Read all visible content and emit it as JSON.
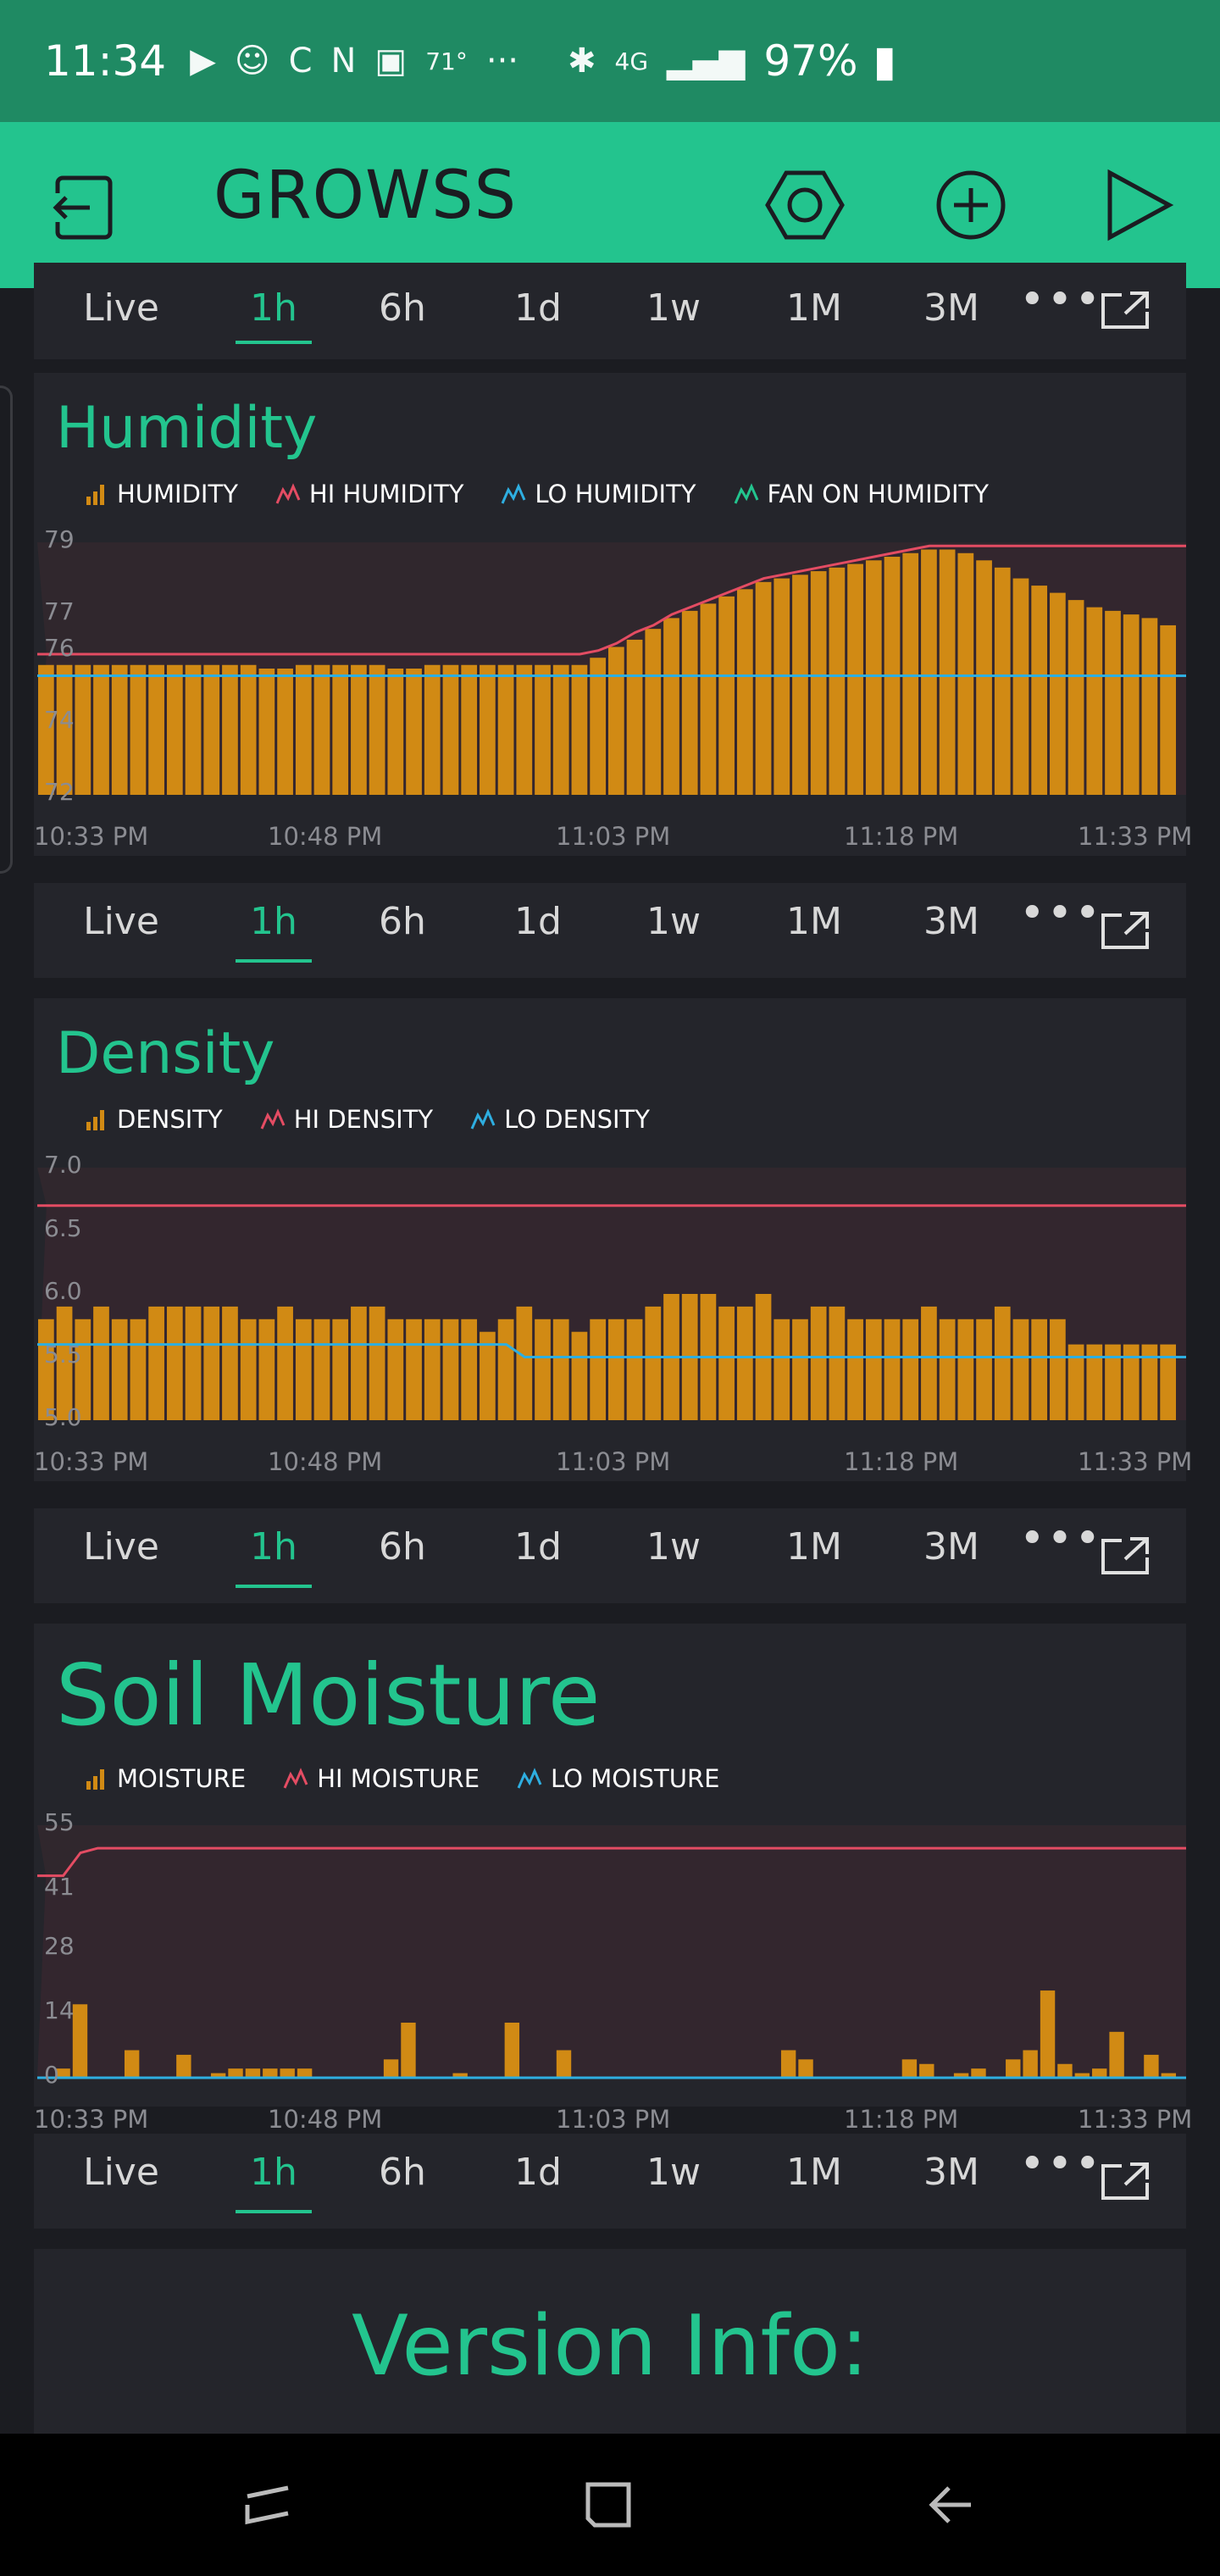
{
  "status_bar": {
    "time": "11:34",
    "temperature": "71°",
    "more": "···",
    "network": "4G",
    "battery": "97%"
  },
  "app_bar": {
    "title": "GROWSS"
  },
  "time_tabs": [
    "Live",
    "1h",
    "6h",
    "1d",
    "1w",
    "1M",
    "3M"
  ],
  "active_tab": "1h",
  "time_labels": [
    "10:33 PM",
    "10:48 PM",
    "11:03 PM",
    "11:18 PM",
    "11:33 PM"
  ],
  "colors": {
    "accent": "#23c48e",
    "bar": "#d18a14",
    "hi_line": "#e44c63",
    "lo_line": "#2eaee0",
    "fan_line": "#23c48e"
  },
  "widgets": {
    "humidity": {
      "title": "Humidity",
      "legend": [
        "HUMIDITY",
        "HI HUMIDITY",
        "LO HUMIDITY",
        "FAN ON HUMIDITY"
      ],
      "y_ticks": [
        "79",
        "77",
        "76",
        "74",
        "72"
      ]
    },
    "density": {
      "title": "Density",
      "legend": [
        "DENSITY",
        "HI DENSITY",
        "LO DENSITY"
      ],
      "y_ticks": [
        "7.0",
        "6.5",
        "6.0",
        "5.5",
        "5.0"
      ]
    },
    "soil": {
      "title": "Soil Moisture",
      "legend": [
        "MOISTURE",
        "HI MOISTURE",
        "LO MOISTURE"
      ],
      "y_ticks": [
        "55",
        "41",
        "28",
        "14",
        "0"
      ]
    }
  },
  "version": {
    "title": "Version Info:"
  },
  "chart_data": [
    {
      "type": "bar",
      "title": "Humidity",
      "ylim": [
        72,
        79
      ],
      "series": [
        {
          "name": "HUMIDITY",
          "values": [
            75.6,
            75.6,
            75.6,
            75.6,
            75.6,
            75.6,
            75.6,
            75.6,
            75.6,
            75.6,
            75.6,
            75.6,
            75.5,
            75.5,
            75.6,
            75.6,
            75.6,
            75.6,
            75.6,
            75.5,
            75.5,
            75.6,
            75.6,
            75.6,
            75.6,
            75.6,
            75.6,
            75.6,
            75.6,
            75.6,
            75.8,
            76.1,
            76.3,
            76.6,
            76.9,
            77.1,
            77.3,
            77.5,
            77.7,
            77.9,
            78.0,
            78.1,
            78.2,
            78.3,
            78.4,
            78.5,
            78.6,
            78.7,
            78.8,
            78.8,
            78.7,
            78.5,
            78.3,
            78.0,
            77.8,
            77.6,
            77.4,
            77.2,
            77.1,
            77.0,
            76.9,
            76.7
          ]
        },
        {
          "name": "HI HUMIDITY",
          "values": [
            75.9,
            75.9,
            75.9,
            75.9,
            75.9,
            75.9,
            75.9,
            75.9,
            75.9,
            75.9,
            75.9,
            75.9,
            75.9,
            75.9,
            75.9,
            75.9,
            75.9,
            75.9,
            75.9,
            75.9,
            75.9,
            75.9,
            75.9,
            75.9,
            75.9,
            75.9,
            75.9,
            75.9,
            75.9,
            75.9,
            76.0,
            76.2,
            76.5,
            76.7,
            77.0,
            77.2,
            77.4,
            77.6,
            77.8,
            78.0,
            78.1,
            78.2,
            78.3,
            78.4,
            78.5,
            78.6,
            78.7,
            78.8,
            78.9,
            78.9,
            78.9,
            78.9,
            78.9,
            78.9,
            78.9,
            78.9,
            78.9,
            78.9,
            78.9,
            78.9,
            78.9,
            78.9
          ]
        },
        {
          "name": "LO HUMIDITY",
          "values": [
            75.3,
            75.3,
            75.3,
            75.3,
            75.3,
            75.3,
            75.3,
            75.3,
            75.3,
            75.3,
            75.3,
            75.3,
            75.3,
            75.3,
            75.3,
            75.3,
            75.3,
            75.3,
            75.3,
            75.3,
            75.3,
            75.3,
            75.3,
            75.3,
            75.3,
            75.3,
            75.3,
            75.3,
            75.3,
            75.3,
            75.3,
            75.3,
            75.3,
            75.3,
            75.3,
            75.3,
            75.3,
            75.3,
            75.3,
            75.3,
            75.3,
            75.3,
            75.3,
            75.3,
            75.3,
            75.3,
            75.3,
            75.3,
            75.3,
            75.3,
            75.3,
            75.3,
            75.3,
            75.3,
            75.3,
            75.3,
            75.3,
            75.3,
            75.3,
            75.3,
            75.3,
            75.3
          ]
        },
        {
          "name": "FAN ON HUMIDITY",
          "values": []
        }
      ]
    },
    {
      "type": "bar",
      "title": "Density",
      "ylim": [
        5.0,
        7.0
      ],
      "series": [
        {
          "name": "DENSITY",
          "values": [
            5.8,
            5.9,
            5.8,
            5.9,
            5.8,
            5.8,
            5.9,
            5.9,
            5.9,
            5.9,
            5.9,
            5.8,
            5.8,
            5.9,
            5.8,
            5.8,
            5.8,
            5.9,
            5.9,
            5.8,
            5.8,
            5.8,
            5.8,
            5.8,
            5.7,
            5.8,
            5.9,
            5.8,
            5.8,
            5.7,
            5.8,
            5.8,
            5.8,
            5.9,
            6.0,
            6.0,
            6.0,
            5.9,
            5.9,
            6.0,
            5.8,
            5.8,
            5.9,
            5.9,
            5.8,
            5.8,
            5.8,
            5.8,
            5.9,
            5.8,
            5.8,
            5.8,
            5.9,
            5.8,
            5.8,
            5.8,
            5.6,
            5.6,
            5.6,
            5.6,
            5.6,
            5.6
          ]
        },
        {
          "name": "HI DENSITY",
          "values": [
            6.7,
            6.7,
            6.7,
            6.7,
            6.7,
            6.7,
            6.7,
            6.7,
            6.7,
            6.7,
            6.7,
            6.7,
            6.7,
            6.7,
            6.7,
            6.7,
            6.7,
            6.7,
            6.7,
            6.7,
            6.7,
            6.7,
            6.7,
            6.7,
            6.7,
            6.7,
            6.7,
            6.7,
            6.7,
            6.7,
            6.7,
            6.7,
            6.7,
            6.7,
            6.7,
            6.7,
            6.7,
            6.7,
            6.7,
            6.7,
            6.7,
            6.7,
            6.7,
            6.7,
            6.7,
            6.7,
            6.7,
            6.7,
            6.7,
            6.7,
            6.7,
            6.7,
            6.7,
            6.7,
            6.7,
            6.7,
            6.7,
            6.7,
            6.7,
            6.7,
            6.7,
            6.7
          ]
        },
        {
          "name": "LO DENSITY",
          "values": [
            5.6,
            5.6,
            5.6,
            5.6,
            5.6,
            5.6,
            5.6,
            5.6,
            5.6,
            5.6,
            5.6,
            5.6,
            5.6,
            5.6,
            5.6,
            5.6,
            5.6,
            5.6,
            5.6,
            5.6,
            5.6,
            5.6,
            5.6,
            5.6,
            5.6,
            5.6,
            5.5,
            5.5,
            5.5,
            5.5,
            5.5,
            5.5,
            5.5,
            5.5,
            5.5,
            5.5,
            5.5,
            5.5,
            5.5,
            5.5,
            5.5,
            5.5,
            5.5,
            5.5,
            5.5,
            5.5,
            5.5,
            5.5,
            5.5,
            5.5,
            5.5,
            5.5,
            5.5,
            5.5,
            5.5,
            5.5,
            5.5,
            5.5,
            5.5,
            5.5,
            5.5,
            5.5
          ]
        }
      ]
    },
    {
      "type": "bar",
      "title": "Soil Moisture",
      "ylim": [
        0,
        55
      ],
      "series": [
        {
          "name": "MOISTURE",
          "values": [
            0,
            2,
            16,
            0,
            0,
            6,
            0,
            0,
            5,
            0,
            1,
            2,
            2,
            2,
            2,
            2,
            0,
            0,
            0,
            0,
            4,
            12,
            0,
            0,
            1,
            0,
            0,
            12,
            0,
            0,
            6,
            0,
            0,
            0,
            0,
            0,
            0,
            0,
            0,
            0,
            0,
            0,
            0,
            6,
            4,
            0,
            0,
            0,
            0,
            0,
            4,
            3,
            0,
            1,
            2,
            0,
            4,
            6,
            19,
            3,
            1,
            2,
            10,
            0,
            5,
            1
          ]
        },
        {
          "name": "HI MOISTURE",
          "values": [
            44,
            44,
            49,
            50,
            50,
            50,
            50,
            50,
            50,
            50,
            50,
            50,
            50,
            50,
            50,
            50,
            50,
            50,
            50,
            50,
            50,
            50,
            50,
            50,
            50,
            50,
            50,
            50,
            50,
            50,
            50,
            50,
            50,
            50,
            50,
            50,
            50,
            50,
            50,
            50,
            50,
            50,
            50,
            50,
            50,
            50,
            50,
            50,
            50,
            50,
            50,
            50,
            50,
            50,
            50,
            50,
            50,
            50,
            50,
            50,
            50,
            50,
            50,
            50,
            50,
            50
          ]
        },
        {
          "name": "LO MOISTURE",
          "values": [
            0,
            0,
            0,
            0,
            0,
            0,
            0,
            0,
            0,
            0,
            0,
            0,
            0,
            0,
            0,
            0,
            0,
            0,
            0,
            0,
            0,
            0,
            0,
            0,
            0,
            0,
            0,
            0,
            0,
            0,
            0,
            0,
            0,
            0,
            0,
            0,
            0,
            0,
            0,
            0,
            0,
            0,
            0,
            0,
            0,
            0,
            0,
            0,
            0,
            0,
            0,
            0,
            0,
            0,
            0,
            0,
            0,
            0,
            0,
            0,
            0,
            0,
            0,
            0,
            0,
            0
          ]
        }
      ]
    }
  ]
}
